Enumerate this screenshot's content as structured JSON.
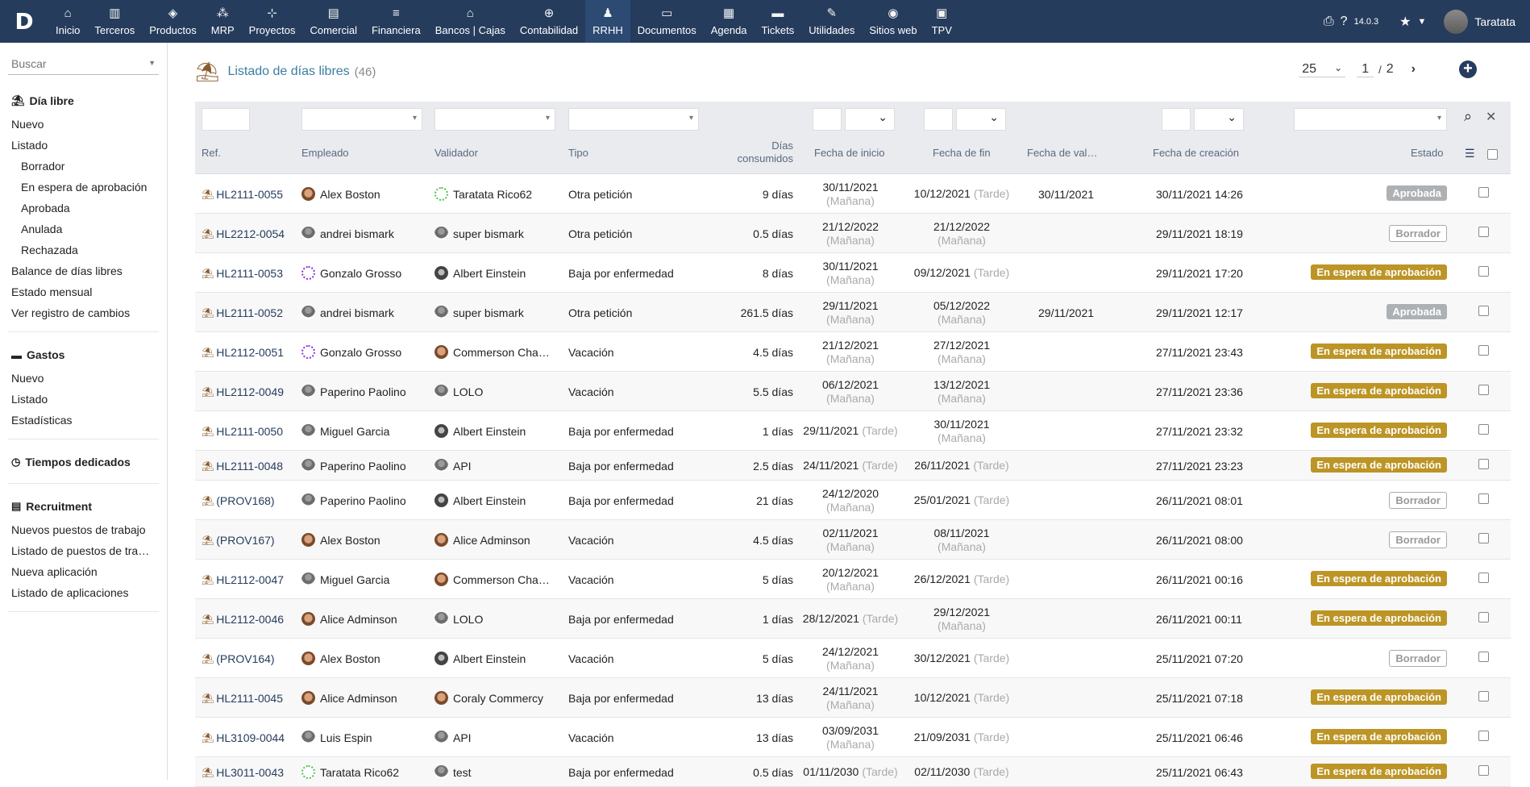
{
  "app": {
    "logo": "D",
    "menu": [
      {
        "label": "Inicio",
        "icon": "home-icon",
        "glyph": "⌂"
      },
      {
        "label": "Terceros",
        "icon": "building-icon",
        "glyph": "▥"
      },
      {
        "label": "Productos",
        "icon": "cube-icon",
        "glyph": "◈"
      },
      {
        "label": "MRP",
        "icon": "cubes-icon",
        "glyph": "⁂"
      },
      {
        "label": "Proyectos",
        "icon": "sitemap-icon",
        "glyph": "⊹"
      },
      {
        "label": "Comercial",
        "icon": "suitcase-icon",
        "glyph": "▤"
      },
      {
        "label": "Financiera",
        "icon": "coins-icon",
        "glyph": "≡"
      },
      {
        "label": "Bancos | Cajas",
        "icon": "bank-icon",
        "glyph": "⌂"
      },
      {
        "label": "Contabilidad",
        "icon": "search-dollar-icon",
        "glyph": "⊕"
      },
      {
        "label": "RRHH",
        "icon": "user-tie-icon",
        "glyph": "♟"
      },
      {
        "label": "Documentos",
        "icon": "folder-icon",
        "glyph": "▭"
      },
      {
        "label": "Agenda",
        "icon": "calendar-icon",
        "glyph": "▦"
      },
      {
        "label": "Tickets",
        "icon": "ticket-icon",
        "glyph": "▬"
      },
      {
        "label": "Utilidades",
        "icon": "wrench-icon",
        "glyph": "✎"
      },
      {
        "label": "Sitios web",
        "icon": "globe-icon",
        "glyph": "◉"
      },
      {
        "label": "TPV",
        "icon": "cash-register-icon",
        "glyph": "▣"
      }
    ],
    "version": "14.0.3",
    "user": "Taratata"
  },
  "sidebar": {
    "search_placeholder": "Buscar",
    "groups": [
      {
        "title": "Día libre",
        "icon": "umbrella-beach-icon",
        "glyph": "⛱",
        "items": [
          {
            "label": "Nuevo",
            "sub": false
          },
          {
            "label": "Listado",
            "sub": false
          },
          {
            "label": "Borrador",
            "sub": true
          },
          {
            "label": "En espera de aprobación",
            "sub": true
          },
          {
            "label": "Aprobada",
            "sub": true
          },
          {
            "label": "Anulada",
            "sub": true
          },
          {
            "label": "Rechazada",
            "sub": true
          },
          {
            "label": "Balance de días libres",
            "sub": false
          },
          {
            "label": "Estado mensual",
            "sub": false
          },
          {
            "label": "Ver registro de cambios",
            "sub": false
          }
        ]
      },
      {
        "title": "Gastos",
        "icon": "wallet-icon",
        "glyph": "▬",
        "items": [
          {
            "label": "Nuevo",
            "sub": false
          },
          {
            "label": "Listado",
            "sub": false
          },
          {
            "label": "Estadísticas",
            "sub": false
          }
        ]
      },
      {
        "title": "Tiempos dedicados",
        "icon": "clock-icon",
        "glyph": "◷",
        "items": []
      },
      {
        "title": "Recruitment",
        "icon": "id-badge-icon",
        "glyph": "▤",
        "items": [
          {
            "label": "Nuevos puestos de trabajo",
            "sub": false
          },
          {
            "label": "Listado de puestos de tra…",
            "sub": false
          },
          {
            "label": "Nueva aplicación",
            "sub": false
          },
          {
            "label": "Listado de aplicaciones",
            "sub": false
          }
        ]
      }
    ]
  },
  "main": {
    "title": "Listado de días libres",
    "count": "(46)",
    "page_size": "25",
    "page": "1",
    "page_sep": "/",
    "pages": "2",
    "columns": {
      "ref": "Ref.",
      "empleado": "Empleado",
      "validador": "Validador",
      "tipo": "Tipo",
      "dias_1": "Días",
      "dias_2": "consumidos",
      "inicio": "Fecha de inicio",
      "fin": "Fecha de fin",
      "val": "Fecha de val…",
      "creacion": "Fecha de creación",
      "estado": "Estado"
    },
    "rows": [
      {
        "ref": "HL2111-0055",
        "emp": "Alex Boston",
        "emp_av": "face",
        "val": "Taratata Rico62",
        "val_av": "green",
        "tipo": "Otra petición",
        "dias": "9 días",
        "ini": "30/11/2021",
        "ini_p": "(Mañana)",
        "ini_stacked": true,
        "fin": "10/12/2021",
        "fin_p": "(Tarde)",
        "fin_stacked": false,
        "fval": "30/11/2021",
        "cre": "30/11/2021 14:26",
        "estado": "Aprobada",
        "st": "ok"
      },
      {
        "ref": "HL2212-0054",
        "emp": "andrei bismark",
        "emp_av": "gray",
        "val": "super bismark",
        "val_av": "gray",
        "tipo": "Otra petición",
        "dias": "0.5 días",
        "ini": "21/12/2022",
        "ini_p": "(Mañana)",
        "ini_stacked": true,
        "fin": "21/12/2022",
        "fin_p": "(Mañana)",
        "fin_stacked": true,
        "fval": "",
        "cre": "29/11/2021 18:19",
        "estado": "Borrador",
        "st": "draft"
      },
      {
        "ref": "HL2111-0053",
        "emp": "Gonzalo Grosso",
        "emp_av": "ring",
        "val": "Albert Einstein",
        "val_av": "dark",
        "tipo": "Baja por enfermedad",
        "dias": "8 días",
        "ini": "30/11/2021",
        "ini_p": "(Mañana)",
        "ini_stacked": true,
        "fin": "09/12/2021",
        "fin_p": "(Tarde)",
        "fin_stacked": false,
        "fval": "",
        "cre": "29/11/2021 17:20",
        "estado": "En espera de aprobación",
        "st": "wait"
      },
      {
        "ref": "HL2111-0052",
        "emp": "andrei bismark",
        "emp_av": "gray",
        "val": "super bismark",
        "val_av": "gray",
        "tipo": "Otra petición",
        "dias": "261.5 días",
        "ini": "29/11/2021",
        "ini_p": "(Mañana)",
        "ini_stacked": true,
        "fin": "05/12/2022",
        "fin_p": "(Mañana)",
        "fin_stacked": true,
        "fval": "29/11/2021",
        "cre": "29/11/2021 12:17",
        "estado": "Aprobada",
        "st": "ok"
      },
      {
        "ref": "HL2112-0051",
        "emp": "Gonzalo Grosso",
        "emp_av": "ring",
        "val": "Commerson Cha…",
        "val_av": "face",
        "tipo": "Vacación",
        "dias": "4.5 días",
        "ini": "21/12/2021",
        "ini_p": "(Mañana)",
        "ini_stacked": true,
        "fin": "27/12/2021",
        "fin_p": "(Mañana)",
        "fin_stacked": true,
        "fval": "",
        "cre": "27/11/2021 23:43",
        "estado": "En espera de aprobación",
        "st": "wait"
      },
      {
        "ref": "HL2112-0049",
        "emp": "Paperino Paolino",
        "emp_av": "gray",
        "val": "LOLO",
        "val_av": "gray",
        "tipo": "Vacación",
        "dias": "5.5 días",
        "ini": "06/12/2021",
        "ini_p": "(Mañana)",
        "ini_stacked": true,
        "fin": "13/12/2021",
        "fin_p": "(Mañana)",
        "fin_stacked": true,
        "fval": "",
        "cre": "27/11/2021 23:36",
        "estado": "En espera de aprobación",
        "st": "wait"
      },
      {
        "ref": "HL2111-0050",
        "emp": "Miguel Garcia",
        "emp_av": "gray",
        "val": "Albert Einstein",
        "val_av": "dark",
        "tipo": "Baja por enfermedad",
        "dias": "1 días",
        "ini": "29/11/2021",
        "ini_p": "(Tarde)",
        "ini_stacked": false,
        "fin": "30/11/2021",
        "fin_p": "(Mañana)",
        "fin_stacked": true,
        "fval": "",
        "cre": "27/11/2021 23:32",
        "estado": "En espera de aprobación",
        "st": "wait"
      },
      {
        "ref": "HL2111-0048",
        "emp": "Paperino Paolino",
        "emp_av": "gray",
        "val": "API",
        "val_av": "gray",
        "tipo": "Baja por enfermedad",
        "dias": "2.5 días",
        "ini": "24/11/2021",
        "ini_p": "(Tarde)",
        "ini_stacked": false,
        "fin": "26/11/2021",
        "fin_p": "(Tarde)",
        "fin_stacked": false,
        "fval": "",
        "cre": "27/11/2021 23:23",
        "estado": "En espera de aprobación",
        "st": "wait"
      },
      {
        "ref": "(PROV168)",
        "emp": "Paperino Paolino",
        "emp_av": "gray",
        "val": "Albert Einstein",
        "val_av": "dark",
        "tipo": "Baja por enfermedad",
        "dias": "21 días",
        "ini": "24/12/2020",
        "ini_p": "(Mañana)",
        "ini_stacked": true,
        "fin": "25/01/2021",
        "fin_p": "(Tarde)",
        "fin_stacked": false,
        "fval": "",
        "cre": "26/11/2021 08:01",
        "estado": "Borrador",
        "st": "draft"
      },
      {
        "ref": "(PROV167)",
        "emp": "Alex Boston",
        "emp_av": "face",
        "val": "Alice Adminson",
        "val_av": "face",
        "tipo": "Vacación",
        "dias": "4.5 días",
        "ini": "02/11/2021",
        "ini_p": "(Mañana)",
        "ini_stacked": true,
        "fin": "08/11/2021",
        "fin_p": "(Mañana)",
        "fin_stacked": true,
        "fval": "",
        "cre": "26/11/2021 08:00",
        "estado": "Borrador",
        "st": "draft"
      },
      {
        "ref": "HL2112-0047",
        "emp": "Miguel Garcia",
        "emp_av": "gray",
        "val": "Commerson Cha…",
        "val_av": "face",
        "tipo": "Vacación",
        "dias": "5 días",
        "ini": "20/12/2021",
        "ini_p": "(Mañana)",
        "ini_stacked": true,
        "fin": "26/12/2021",
        "fin_p": "(Tarde)",
        "fin_stacked": false,
        "fval": "",
        "cre": "26/11/2021 00:16",
        "estado": "En espera de aprobación",
        "st": "wait"
      },
      {
        "ref": "HL2112-0046",
        "emp": "Alice Adminson",
        "emp_av": "face",
        "val": "LOLO",
        "val_av": "gray",
        "tipo": "Baja por enfermedad",
        "dias": "1 días",
        "ini": "28/12/2021",
        "ini_p": "(Tarde)",
        "ini_stacked": false,
        "fin": "29/12/2021",
        "fin_p": "(Mañana)",
        "fin_stacked": true,
        "fval": "",
        "cre": "26/11/2021 00:11",
        "estado": "En espera de aprobación",
        "st": "wait"
      },
      {
        "ref": "(PROV164)",
        "emp": "Alex Boston",
        "emp_av": "face",
        "val": "Albert Einstein",
        "val_av": "dark",
        "tipo": "Vacación",
        "dias": "5 días",
        "ini": "24/12/2021",
        "ini_p": "(Mañana)",
        "ini_stacked": true,
        "fin": "30/12/2021",
        "fin_p": "(Tarde)",
        "fin_stacked": false,
        "fval": "",
        "cre": "25/11/2021 07:20",
        "estado": "Borrador",
        "st": "draft"
      },
      {
        "ref": "HL2111-0045",
        "emp": "Alice Adminson",
        "emp_av": "face",
        "val": "Coraly Commercy",
        "val_av": "face",
        "tipo": "Baja por enfermedad",
        "dias": "13 días",
        "ini": "24/11/2021",
        "ini_p": "(Mañana)",
        "ini_stacked": true,
        "fin": "10/12/2021",
        "fin_p": "(Tarde)",
        "fin_stacked": false,
        "fval": "",
        "cre": "25/11/2021 07:18",
        "estado": "En espera de aprobación",
        "st": "wait"
      },
      {
        "ref": "HL3109-0044",
        "emp": "Luis Espin",
        "emp_av": "gray",
        "val": "API",
        "val_av": "gray",
        "tipo": "Vacación",
        "dias": "13 días",
        "ini": "03/09/2031",
        "ini_p": "(Mañana)",
        "ini_stacked": true,
        "fin": "21/09/2031",
        "fin_p": "(Tarde)",
        "fin_stacked": false,
        "fval": "",
        "cre": "25/11/2021 06:46",
        "estado": "En espera de aprobación",
        "st": "wait"
      },
      {
        "ref": "HL3011-0043",
        "emp": "Taratata Rico62",
        "emp_av": "green",
        "val": "test",
        "val_av": "gray",
        "tipo": "Baja por enfermedad",
        "dias": "0.5 días",
        "ini": "01/11/2030",
        "ini_p": "(Tarde)",
        "ini_stacked": false,
        "fin": "02/11/2030",
        "fin_p": "(Tarde)",
        "fin_stacked": false,
        "fval": "",
        "cre": "25/11/2021 06:43",
        "estado": "En espera de aprobación",
        "st": "wait"
      }
    ]
  }
}
